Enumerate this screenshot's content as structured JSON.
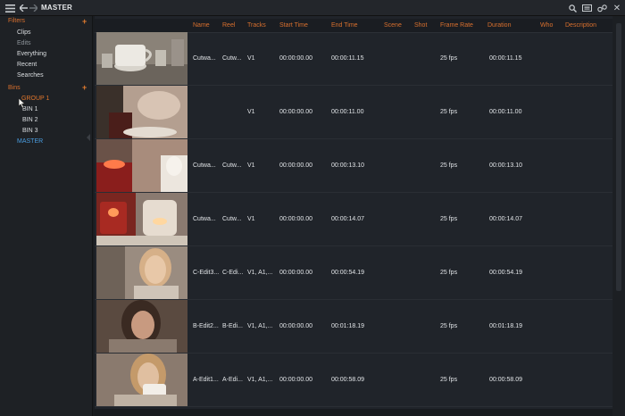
{
  "titlebar": {
    "title": "MASTER",
    "icons": [
      "menu-icon",
      "back-arrow-icon",
      "forward-arrow-icon",
      "search-icon",
      "keyboard-icon",
      "link-icon",
      "close-icon"
    ]
  },
  "sidebar": {
    "filters_label": "Filters",
    "filters": [
      "Clips",
      "Edits",
      "Everything",
      "Recent",
      "Searches"
    ],
    "bins_label": "Bins",
    "group_label": "GROUP 1",
    "bins": [
      "BIN 1",
      "BIN 2",
      "BIN 3"
    ],
    "master_label": "MASTER"
  },
  "table": {
    "headers": [
      "Name",
      "Reel",
      "Tracks",
      "Start Time",
      "End Time",
      "Scene",
      "Shot",
      "Frame Rate",
      "Duration",
      "Who",
      "Description"
    ],
    "rows": [
      {
        "name": "Cutwa...",
        "reel": "Cutw...",
        "tracks": "V1",
        "start": "00:00:00.00",
        "end": "00:00:11.15",
        "fps": "25 fps",
        "duration": "00:00:11.15",
        "thumb": "cup-scene"
      },
      {
        "name": "",
        "reel": "",
        "tracks": "V1",
        "start": "00:00:00.00",
        "end": "00:00:11.00",
        "fps": "25 fps",
        "duration": "00:00:11.00",
        "thumb": "pouring-scene"
      },
      {
        "name": "Cutwa...",
        "reel": "Cutw...",
        "tracks": "V1",
        "start": "00:00:00.00",
        "end": "00:00:13.10",
        "fps": "25 fps",
        "duration": "00:00:13.10",
        "thumb": "red-candle-scene"
      },
      {
        "name": "Cutwa...",
        "reel": "Cutw...",
        "tracks": "V1",
        "start": "00:00:00.00",
        "end": "00:00:14.07",
        "fps": "25 fps",
        "duration": "00:00:14.07",
        "thumb": "candles-scene"
      },
      {
        "name": "C-Edit3...",
        "reel": "C-Edi...",
        "tracks": "V1, A1,...",
        "start": "00:00:00.00",
        "end": "00:00:54.19",
        "fps": "25 fps",
        "duration": "00:00:54.19",
        "thumb": "blonde-woman"
      },
      {
        "name": "B-Edit2...",
        "reel": "B-Edi...",
        "tracks": "V1, A1,...",
        "start": "00:00:00.00",
        "end": "00:01:18.19",
        "fps": "25 fps",
        "duration": "00:01:18.19",
        "thumb": "brunette-woman"
      },
      {
        "name": "A-Edit1...",
        "reel": "A-Edi...",
        "tracks": "V1, A1,...",
        "start": "00:00:00.00",
        "end": "00:00:58.09",
        "fps": "25 fps",
        "duration": "00:00:58.09",
        "thumb": "woman-drinking"
      }
    ]
  },
  "colors": {
    "accent": "#d9702e",
    "selected_bin": "#4a9de0",
    "background": "#20242a"
  }
}
